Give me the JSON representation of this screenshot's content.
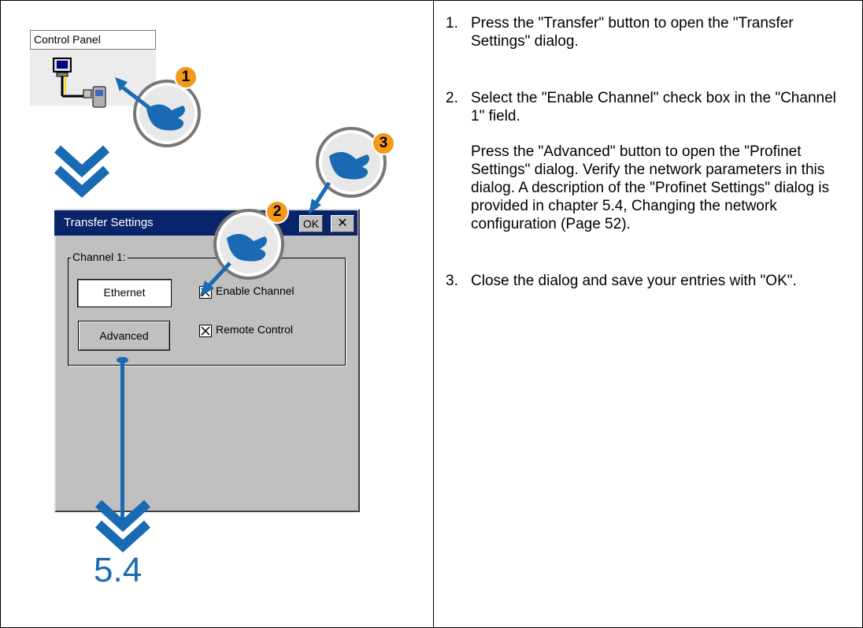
{
  "control_panel": {
    "title": "Control Panel",
    "icon": "transfer-icon"
  },
  "dialog": {
    "title": "Transfer Settings",
    "ok_label": "OK",
    "close_glyph": "✕",
    "group_label": "Channel 1:",
    "protocol_value": "Ethernet",
    "advanced_label": "Advanced",
    "enable_channel_label": "Enable Channel",
    "enable_channel_checked": true,
    "remote_control_label": "Remote Control",
    "remote_control_checked": true
  },
  "callouts": [
    "1",
    "2",
    "3"
  ],
  "reference": "5.4",
  "colors": {
    "accent_blue": "#1a6ab3",
    "callout_orange": "#f39a1b",
    "titlebar": "#0a246a"
  },
  "steps": [
    {
      "num": "1.",
      "paragraphs": [
        "Press the \"Transfer\" button to open the \"Transfer Settings\" dialog."
      ]
    },
    {
      "num": "2.",
      "paragraphs": [
        "Select the \"Enable Channel\" check box in the \"Channel 1\" field.",
        "Press the \"Advanced\" button to open the \"Profinet Settings\" dialog. Verify the network parameters in this dialog. A description of the \"Profinet Settings\" dialog is provided in chapter 5.4, Changing the network configuration (Page 52)."
      ]
    },
    {
      "num": "3.",
      "paragraphs": [
        "Close the dialog and save your entries with \"OK\"."
      ]
    }
  ]
}
